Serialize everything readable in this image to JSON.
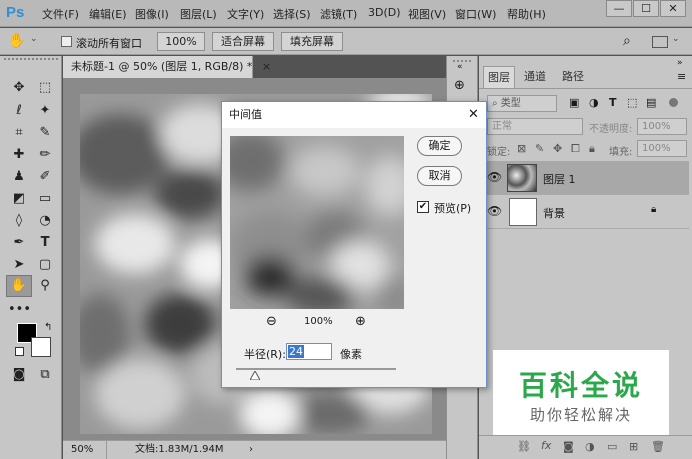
{
  "app": {
    "logo": "Ps"
  },
  "menu": [
    "文件(F)",
    "编辑(E)",
    "图像(I)",
    "图层(L)",
    "文字(Y)",
    "选择(S)",
    "滤镜(T)",
    "3D(D)",
    "视图(V)",
    "窗口(W)",
    "帮助(H)"
  ],
  "window_controls": {
    "minimize": "—",
    "restore": "☐",
    "close": "✕"
  },
  "options": {
    "scroll_all_label": "滚动所有窗口",
    "zoom_100": "100%",
    "fit_screen": "适合屏幕",
    "fill_screen": "填充屏幕"
  },
  "document": {
    "tab_title": "未标题-1 @ 50% (图层 1, RGB/8) *",
    "close": "×",
    "zoom": "50%",
    "doc_info": "文档:1.83M/1.94M"
  },
  "layers_panel": {
    "tabs": [
      "图层",
      "通道",
      "路径"
    ],
    "kind_filter": "类型",
    "blend_mode": "正常",
    "opacity_label": "不透明度:",
    "opacity_value": "100%",
    "lock_label": "锁定:",
    "fill_label": "填充:",
    "fill_value": "100%",
    "layers": [
      {
        "name": "图层 1"
      },
      {
        "name": "背景"
      }
    ]
  },
  "dialog": {
    "title": "中间值",
    "ok": "确定",
    "cancel": "取消",
    "preview_label": "预览(P)",
    "preview_checked": true,
    "zoom": "100%",
    "radius_label": "半径(R):",
    "radius_value": "24",
    "radius_unit": "像素",
    "radius_slider_fraction": 0.12
  },
  "watermark": {
    "title": "百科全说",
    "subtitle": "助你轻松解决"
  },
  "colors": {
    "accent": "#2e8fd6",
    "watermark_green": "#2aa84a"
  }
}
